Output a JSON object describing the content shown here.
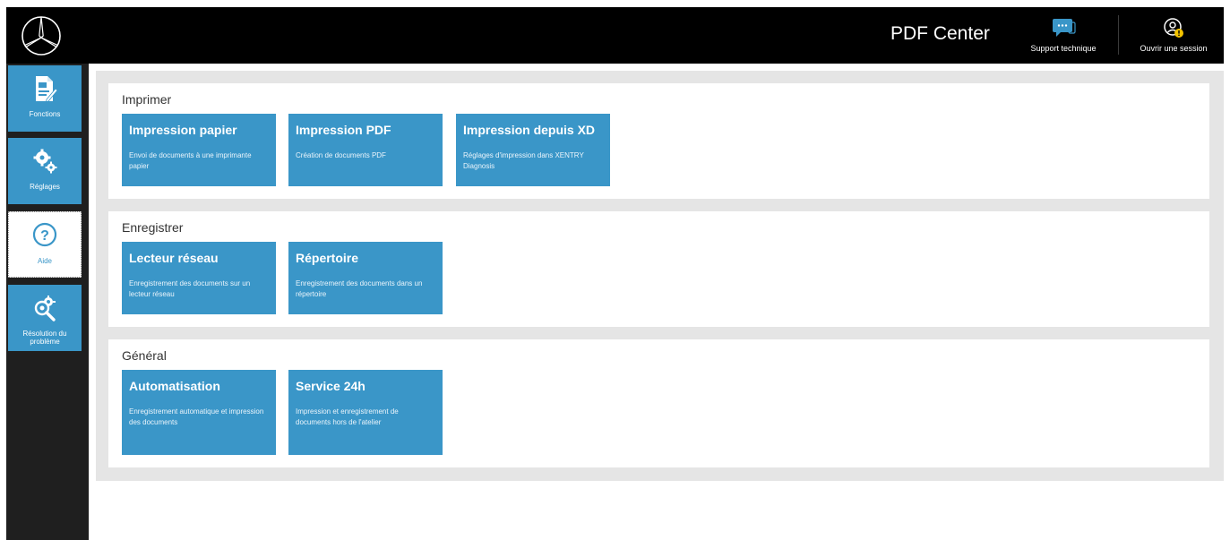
{
  "header": {
    "app_title": "PDF Center",
    "support_label": "Support technique",
    "session_label": "Ouvrir une session",
    "support_icon": "chat-bubble-icon",
    "session_icon": "user-warning-icon",
    "logo": "mercedes-star-logo"
  },
  "sidebar": {
    "items": [
      {
        "label": "Fonctions",
        "icon": "document-edit-icon",
        "active": false
      },
      {
        "label": "Réglages",
        "icon": "gears-icon",
        "active": false
      },
      {
        "label": "Aide",
        "icon": "help-circle-icon",
        "active": true
      },
      {
        "label": "Résolution du problème",
        "icon": "gear-search-icon",
        "active": false
      }
    ]
  },
  "sections": [
    {
      "title": "Imprimer",
      "tiles": [
        {
          "title": "Impression papier",
          "desc": "Envoi de documents à une imprimante papier"
        },
        {
          "title": "Impression PDF",
          "desc": "Création de documents PDF"
        },
        {
          "title": "Impression depuis XD",
          "desc": "Réglages d'impression dans XENTRY Diagnosis"
        }
      ]
    },
    {
      "title": "Enregistrer",
      "tiles": [
        {
          "title": "Lecteur réseau",
          "desc": "Enregistrement des documents sur un lecteur réseau"
        },
        {
          "title": "Répertoire",
          "desc": "Enregistrement des documents dans un répertoire"
        }
      ]
    },
    {
      "title": "Général",
      "tiles": [
        {
          "title": "Automatisation",
          "desc": "Enregistrement automatique et impression des documents"
        },
        {
          "title": "Service 24h",
          "desc": "Impression et enregistrement de documents hors de l'atelier"
        }
      ]
    }
  ],
  "colors": {
    "accent": "#3a96c8",
    "topbar": "#000000",
    "sidebar": "#1f1f1f",
    "panel": "#e5e5e5",
    "warning": "#f2c200"
  }
}
